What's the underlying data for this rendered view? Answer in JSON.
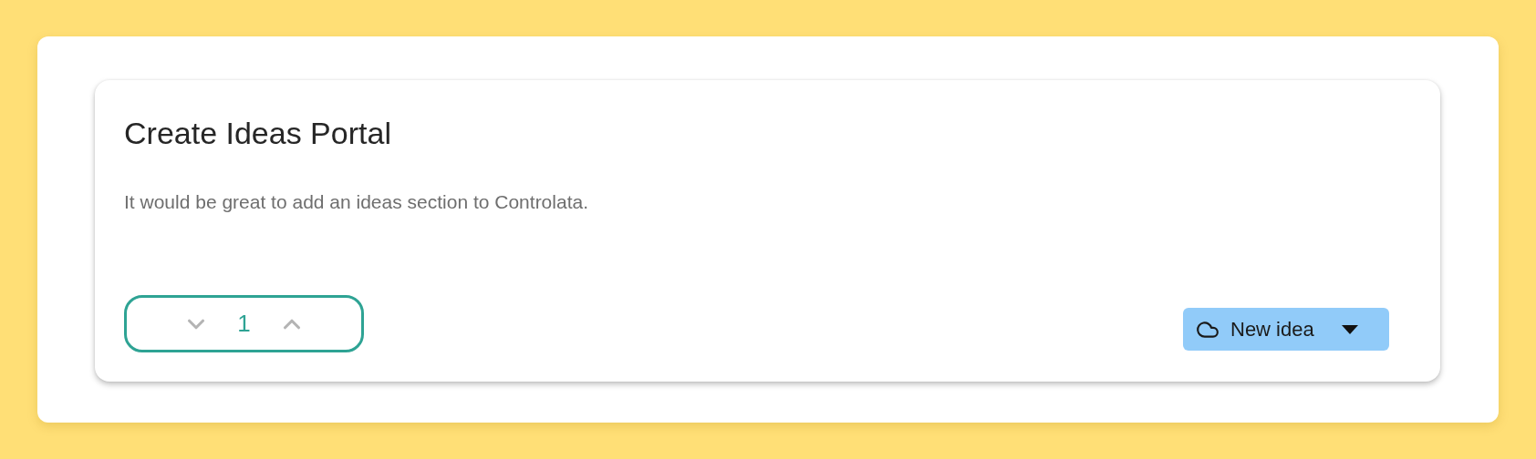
{
  "idea": {
    "title": "Create Ideas Portal",
    "description": "It would be great to add an ideas section to Controlata.",
    "votes": {
      "count": "1"
    },
    "status": {
      "label": "New idea"
    }
  }
}
